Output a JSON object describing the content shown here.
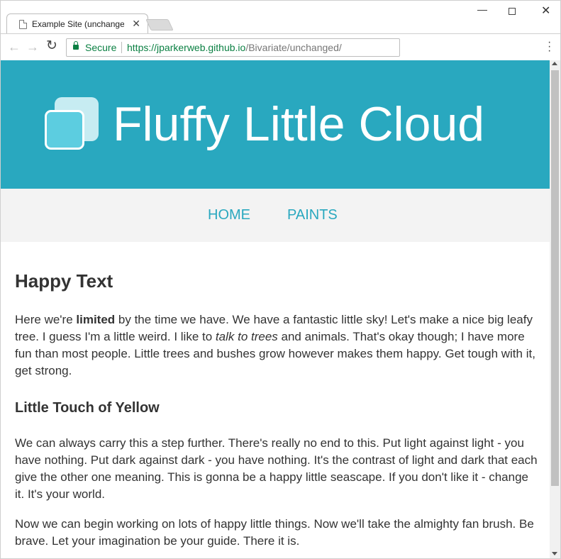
{
  "browser": {
    "tab_title": "Example Site (unchanged)",
    "secure_label": "Secure",
    "url_host": "https://jparkerweb.github.io",
    "url_path": "/Bivariate/unchanged/",
    "icons": {
      "back": "arrow-left-icon",
      "forward": "arrow-right-icon",
      "reload": "reload-icon",
      "lock": "lock-icon",
      "menu": "more-vert-icon",
      "close_tab": "close-icon",
      "favicon": "page-icon"
    }
  },
  "site": {
    "title": "Fluffy Little Cloud",
    "nav": {
      "home": "HOME",
      "paints": "PAINTS"
    },
    "colors": {
      "header": "#29a8bf",
      "nav_bg": "#f3f3f3",
      "link": "#29a8bf",
      "text": "#333333"
    }
  },
  "article": {
    "heading": "Happy Text",
    "p1": {
      "a": "Here we're ",
      "b": "limited",
      "c": " by the time we have. We have a fantastic little sky! Let's make a nice big leafy tree. I guess I'm a little weird. I like to ",
      "d": "talk to trees",
      "e": " and animals. That's okay though; I have more fun than most people. Little trees and bushes grow however makes them happy. Get tough with it, get strong."
    },
    "subheading": "Little Touch of Yellow",
    "p2": "We can always carry this a step further. There's really no end to this. Put light against light - you have nothing. Put dark against dark - you have nothing. It's the contrast of light and dark that each give the other one meaning. This is gonna be a happy little seascape. If you don't like it - change it. It's your world.",
    "p3": "Now we can begin working on lots of happy little things. Now we'll take the almighty fan brush. Be brave. Let your imagination be your guide. There it is."
  }
}
